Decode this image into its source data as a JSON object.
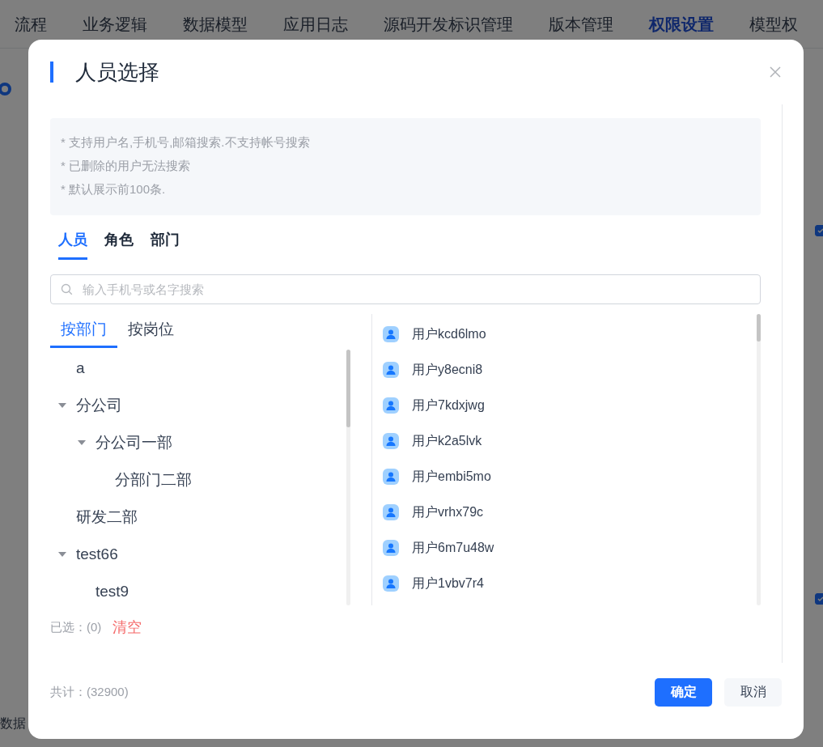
{
  "nav_tabs": [
    {
      "label": "流程",
      "selected": false
    },
    {
      "label": "业务逻辑",
      "selected": false
    },
    {
      "label": "数据模型",
      "selected": false
    },
    {
      "label": "应用日志",
      "selected": false
    },
    {
      "label": "源码开发标识管理",
      "selected": false
    },
    {
      "label": "版本管理",
      "selected": false
    },
    {
      "label": "权限设置",
      "selected": true
    },
    {
      "label": "模型权",
      "selected": false
    }
  ],
  "background_checkboxes": [
    {
      "checked": true
    },
    {
      "checked": true
    }
  ],
  "background_label": "数据",
  "dialog": {
    "title": "人员选择",
    "notes": [
      "* 支持用户名,手机号,邮箱搜索.不支持帐号搜索",
      "* 已删除的用户无法搜索",
      "* 默认展示前100条."
    ],
    "tabs": [
      {
        "label": "人员",
        "selected": true
      },
      {
        "label": "角色",
        "selected": false
      },
      {
        "label": "部门",
        "selected": false
      }
    ],
    "search": {
      "placeholder": "输入手机号或名字搜索"
    },
    "group_tabs": [
      {
        "label": "按部门",
        "selected": true
      },
      {
        "label": "按岗位",
        "selected": false
      }
    ],
    "tree": [
      {
        "label": "a"
      },
      {
        "label": "分公司",
        "expanded": true,
        "children": [
          {
            "label": "分公司一部",
            "expanded": true,
            "children": [
              {
                "label": "分部门二部"
              }
            ]
          }
        ]
      },
      {
        "label": "研发二部"
      },
      {
        "label": "test66",
        "expanded": true,
        "children": [
          {
            "label": "test9"
          }
        ]
      }
    ],
    "users": [
      "用户kcd6lmo",
      "用户y8ecni8",
      "用户7kdxjwg",
      "用户k2a5lvk",
      "用户embi5mo",
      "用户vrhx79c",
      "用户6m7u48w",
      "用户1vbv7r4"
    ],
    "selected_label": "已选：(0)",
    "clear_link": "清空",
    "total_label": "共计：(32900)",
    "buttons": [
      {
        "label": "确定",
        "kind": "primary"
      },
      {
        "label": "取消",
        "kind": "secondary"
      }
    ]
  }
}
